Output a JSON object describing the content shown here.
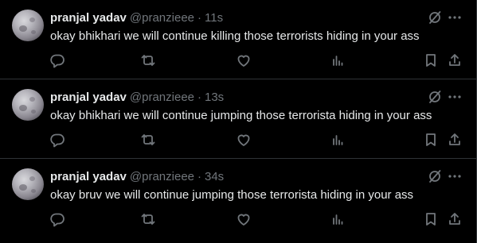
{
  "tweets": [
    {
      "author_name": "pranjal yadav",
      "handle": "@pranzieee",
      "separator": "·",
      "time": "11s",
      "text": "okay bhikhari we will continue killing those terrorists hiding in your ass"
    },
    {
      "author_name": "pranjal yadav",
      "handle": "@pranzieee",
      "separator": "·",
      "time": "13s",
      "text": "okay bhikhari we will continue jumping those terrorista hiding in your ass"
    },
    {
      "author_name": "pranjal yadav",
      "handle": "@pranzieee",
      "separator": "·",
      "time": "34s",
      "text": "okay bruv we will continue jumping those terrorista hiding in your ass"
    }
  ],
  "icons": {
    "top": [
      "grok-icon",
      "more-icon"
    ],
    "actions": [
      "reply-icon",
      "repost-icon",
      "like-icon",
      "views-icon",
      "bookmark-icon",
      "share-icon"
    ]
  },
  "colors": {
    "background": "#000000",
    "primary_text": "#e7e9ea",
    "secondary_text": "#71767b",
    "divider": "#2f3336"
  }
}
